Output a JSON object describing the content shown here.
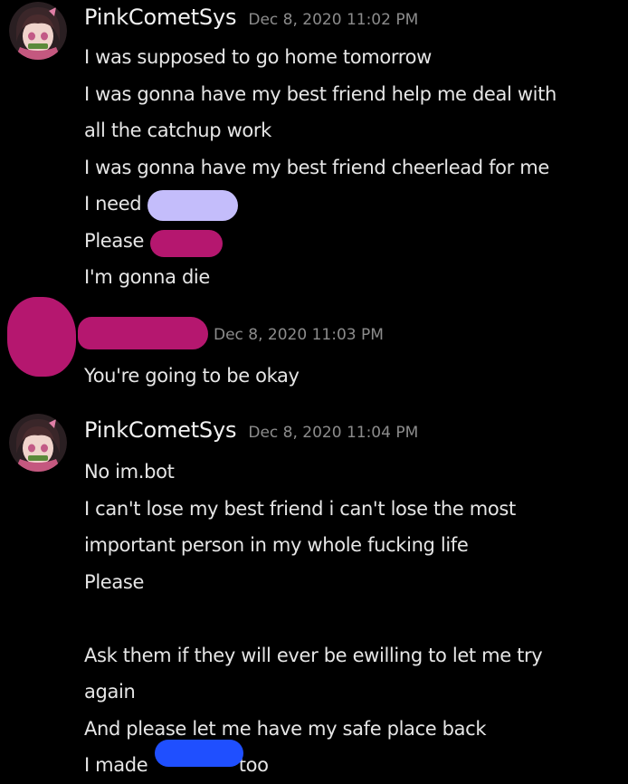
{
  "colors": {
    "background": "#000000",
    "text": "#e6e6e6",
    "timestamp": "#8c8c8c",
    "redact_lavender": "#c4bdfb",
    "redact_magenta": "#b5176f",
    "redact_blue": "#1f4fff"
  },
  "messages": [
    {
      "username": "PinkCometSys",
      "timestamp": "Dec 8, 2020 11:02 PM",
      "lines": [
        "I was supposed to go home tomorrow",
        "I was gonna have my best friend help me deal with",
        "all the catchup work",
        "I was gonna have my best friend cheerlead for me",
        "I need",
        "Please",
        "I'm gonna die"
      ]
    },
    {
      "username": "",
      "timestamp": "Dec 8, 2020 11:03 PM",
      "lines": [
        "You're going to be okay"
      ]
    },
    {
      "username": "PinkCometSys",
      "timestamp": "Dec 8, 2020 11:04 PM",
      "lines": [
        "No im.bot",
        "I can't lose my best friend i can't lose the most",
        "important person in my whole fucking life",
        "Please",
        "",
        "Ask them if they will ever be ewilling to let me try",
        "again",
        "And please let me have my safe place back",
        "I made",
        "too"
      ]
    }
  ]
}
